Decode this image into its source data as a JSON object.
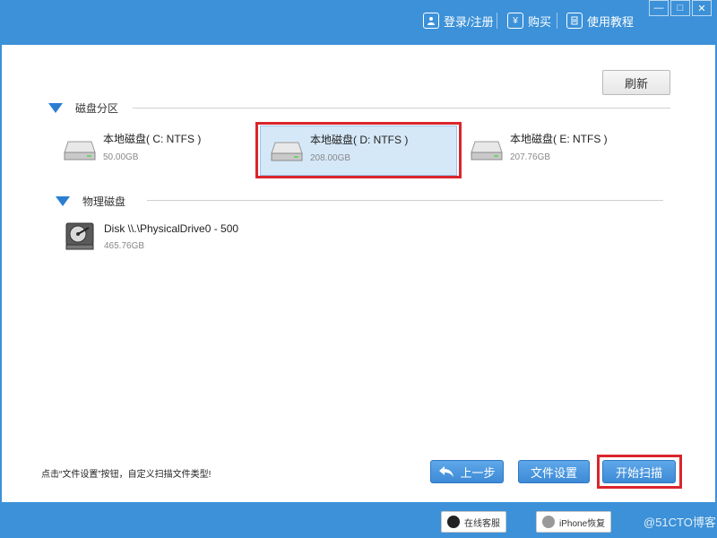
{
  "titlebar": {
    "items": [
      {
        "label": "登录/注册",
        "icon": "user-icon"
      },
      {
        "label": "购买",
        "icon": "yen-icon"
      },
      {
        "label": "使用教程",
        "icon": "doc-icon"
      }
    ],
    "minimize": "—",
    "maximize": "□",
    "close": "✕"
  },
  "toolbar": {
    "refresh_label": "刷新"
  },
  "partitions": {
    "title": "磁盘分区",
    "drives": [
      {
        "name": "本地磁盘( C: NTFS )",
        "size": "50.00GB",
        "selected": false
      },
      {
        "name": "本地磁盘( D: NTFS )",
        "size": "208.00GB",
        "selected": true
      },
      {
        "name": "本地磁盘( E: NTFS )",
        "size": "207.76GB",
        "selected": false
      }
    ]
  },
  "physical": {
    "title": "物理磁盘",
    "disks": [
      {
        "name": "Disk \\\\.\\PhysicalDrive0 - 500",
        "size": "465.76GB"
      }
    ]
  },
  "footer": {
    "hint": "点击“文件设置”按钮，自定义扫描文件类型!",
    "back_label": "上一步",
    "settings_label": "文件设置",
    "start_label": "开始扫描"
  },
  "bottombar": {
    "online_service": "在线客服",
    "iphone_recovery": "iPhone恢复",
    "watermark": "@51CTO博客"
  },
  "colors": {
    "brand": "#3c91d8",
    "accent": "#2a7ed2",
    "highlight": "#d9262c",
    "selected_bg": "#d5e8f8"
  }
}
